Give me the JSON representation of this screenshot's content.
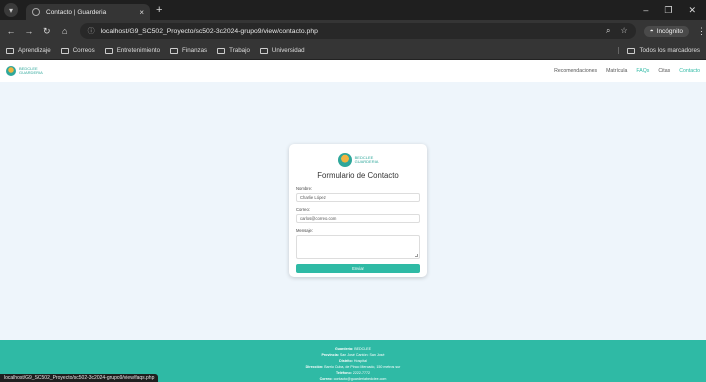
{
  "browser": {
    "tab_title": "Contacto | Guarderia",
    "tab_close": "×",
    "new_tab": "+",
    "url": "localhost/G9_SC502_Proyecto/sc502-3c2024-grupo9/view/contacto.php",
    "incognito_label": "Incógnito",
    "bookmarks": [
      "Aprendizaje",
      "Correos",
      "Entretenimiento",
      "Finanzas",
      "Trabajo",
      "Universidad"
    ],
    "all_bookmarks": "Todos los marcadores"
  },
  "site": {
    "nav": [
      "Recomendaciones",
      "Matrícula",
      "FAQs",
      "Citas",
      "Contacto"
    ],
    "active_nav": "Contacto",
    "brand_line1": "BEDCLEE",
    "brand_line2": "GUARDERIA"
  },
  "form": {
    "title": "Formulario de Contacto",
    "name_label": "Nombre:",
    "name_value": "Charlie López",
    "email_label": "Correo:",
    "email_value": "carlos@correo.com",
    "message_label": "Mensaje:",
    "message_value": "",
    "submit_label": "Enviar"
  },
  "footer": {
    "lines": [
      {
        "k": "Guardería:",
        "v": "BEDCLEE"
      },
      {
        "k": "Provincia:",
        "v": "San José   Cantón: San José"
      },
      {
        "k": "Distrito:",
        "v": "Hospital"
      },
      {
        "k": "Dirección:",
        "v": "Barrio Cuba, de Pinco Mercado, 150 metros sur"
      },
      {
        "k": "Teléfono:",
        "v": "2222-7772"
      },
      {
        "k": "Correo:",
        "v": "contacto@guarderiabedclee.com"
      }
    ]
  },
  "status_url": "localhost/G9_SC502_Proyecto/sc502-3c2024-grupo9/view/faqs.php",
  "colors": {
    "accent": "#2fbaa5",
    "chrome_dark": "#1f1f1f",
    "page_bg": "#eef5fb"
  }
}
